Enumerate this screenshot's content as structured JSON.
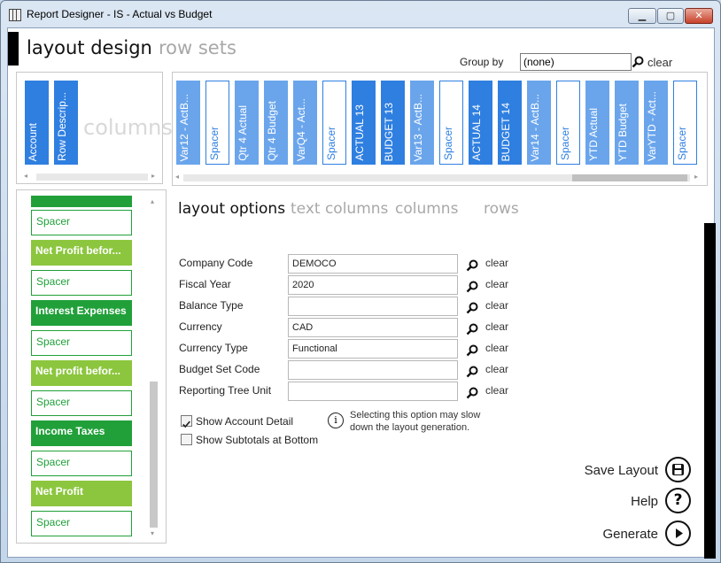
{
  "window": {
    "title": "Report Designer - IS - Actual vs Budget",
    "min_label": "▁",
    "max_label": "▢",
    "close_label": "✕"
  },
  "tabs": {
    "layout_design": "layout design",
    "row_sets": "row sets"
  },
  "group_by": {
    "label": "Group by",
    "value": "(none)",
    "clear": "clear"
  },
  "columns_panel": {
    "ghost": "columns",
    "fixed": [
      {
        "label": "Account"
      },
      {
        "label": "Row Descrip..."
      }
    ],
    "scroll": [
      {
        "label": "Var12 - ActB...",
        "kind": "light"
      },
      {
        "label": "Spacer",
        "kind": "spacer"
      },
      {
        "label": "Qtr 4 Actual",
        "kind": "light"
      },
      {
        "label": "Qtr 4 Budget",
        "kind": "light"
      },
      {
        "label": "VarQ4 - Act...",
        "kind": "light"
      },
      {
        "label": "Spacer",
        "kind": "spacer"
      },
      {
        "label": "ACTUAL 13",
        "kind": "dark"
      },
      {
        "label": "BUDGET 13",
        "kind": "dark"
      },
      {
        "label": "Var13 - ActB...",
        "kind": "light"
      },
      {
        "label": "Spacer",
        "kind": "spacer"
      },
      {
        "label": "ACTUAL 14",
        "kind": "dark"
      },
      {
        "label": "BUDGET 14",
        "kind": "dark"
      },
      {
        "label": "Var14 - ActB...",
        "kind": "light"
      },
      {
        "label": "Spacer",
        "kind": "spacer"
      },
      {
        "label": "YTD Actual",
        "kind": "light"
      },
      {
        "label": "YTD Budget",
        "kind": "light"
      },
      {
        "label": "VarYTD - Act...",
        "kind": "light"
      },
      {
        "label": "Spacer",
        "kind": "spacer"
      }
    ]
  },
  "rows": [
    {
      "label": "",
      "kind": "darkg"
    },
    {
      "label": "Spacer",
      "kind": "spacer"
    },
    {
      "label": "Net Profit befor...",
      "kind": "lightg"
    },
    {
      "label": "Spacer",
      "kind": "spacer"
    },
    {
      "label": "Interest Expenses",
      "kind": "darkg"
    },
    {
      "label": "Spacer",
      "kind": "spacer"
    },
    {
      "label": "Net profit befor...",
      "kind": "lightg"
    },
    {
      "label": "Spacer",
      "kind": "spacer"
    },
    {
      "label": "Income Taxes",
      "kind": "darkg"
    },
    {
      "label": "Spacer",
      "kind": "spacer"
    },
    {
      "label": "Net Profit",
      "kind": "lightg"
    },
    {
      "label": "Spacer",
      "kind": "spacer"
    }
  ],
  "sub_tabs": {
    "layout_options": "layout options",
    "text_columns": "text columns",
    "columns": "columns",
    "rows": "rows"
  },
  "fields": [
    {
      "label": "Company Code",
      "value": "DEMOCO",
      "clear": "clear"
    },
    {
      "label": "Fiscal Year",
      "value": "2020",
      "clear": "clear"
    },
    {
      "label": "Balance Type",
      "value": "",
      "clear": "clear"
    },
    {
      "label": "Currency",
      "value": "CAD",
      "clear": "clear"
    },
    {
      "label": "Currency Type",
      "value": "Functional",
      "clear": "clear"
    },
    {
      "label": "Budget Set Code",
      "value": "",
      "clear": "clear"
    },
    {
      "label": "Reporting Tree Unit",
      "value": "",
      "clear": "clear"
    }
  ],
  "options": {
    "show_account_detail": {
      "label": "Show Account Detail",
      "checked": true
    },
    "show_subtotals": {
      "label": "Show Subtotals at Bottom",
      "checked": false
    },
    "info": "Selecting this option may slow down the layout generation."
  },
  "actions": {
    "save": "Save Layout",
    "help": "Help",
    "generate": "Generate"
  },
  "colors": {
    "tile_dark": "#2f7fe0",
    "tile_light": "#6aa5ec",
    "row_dark": "#21a03a",
    "row_light": "#8cc63e"
  }
}
